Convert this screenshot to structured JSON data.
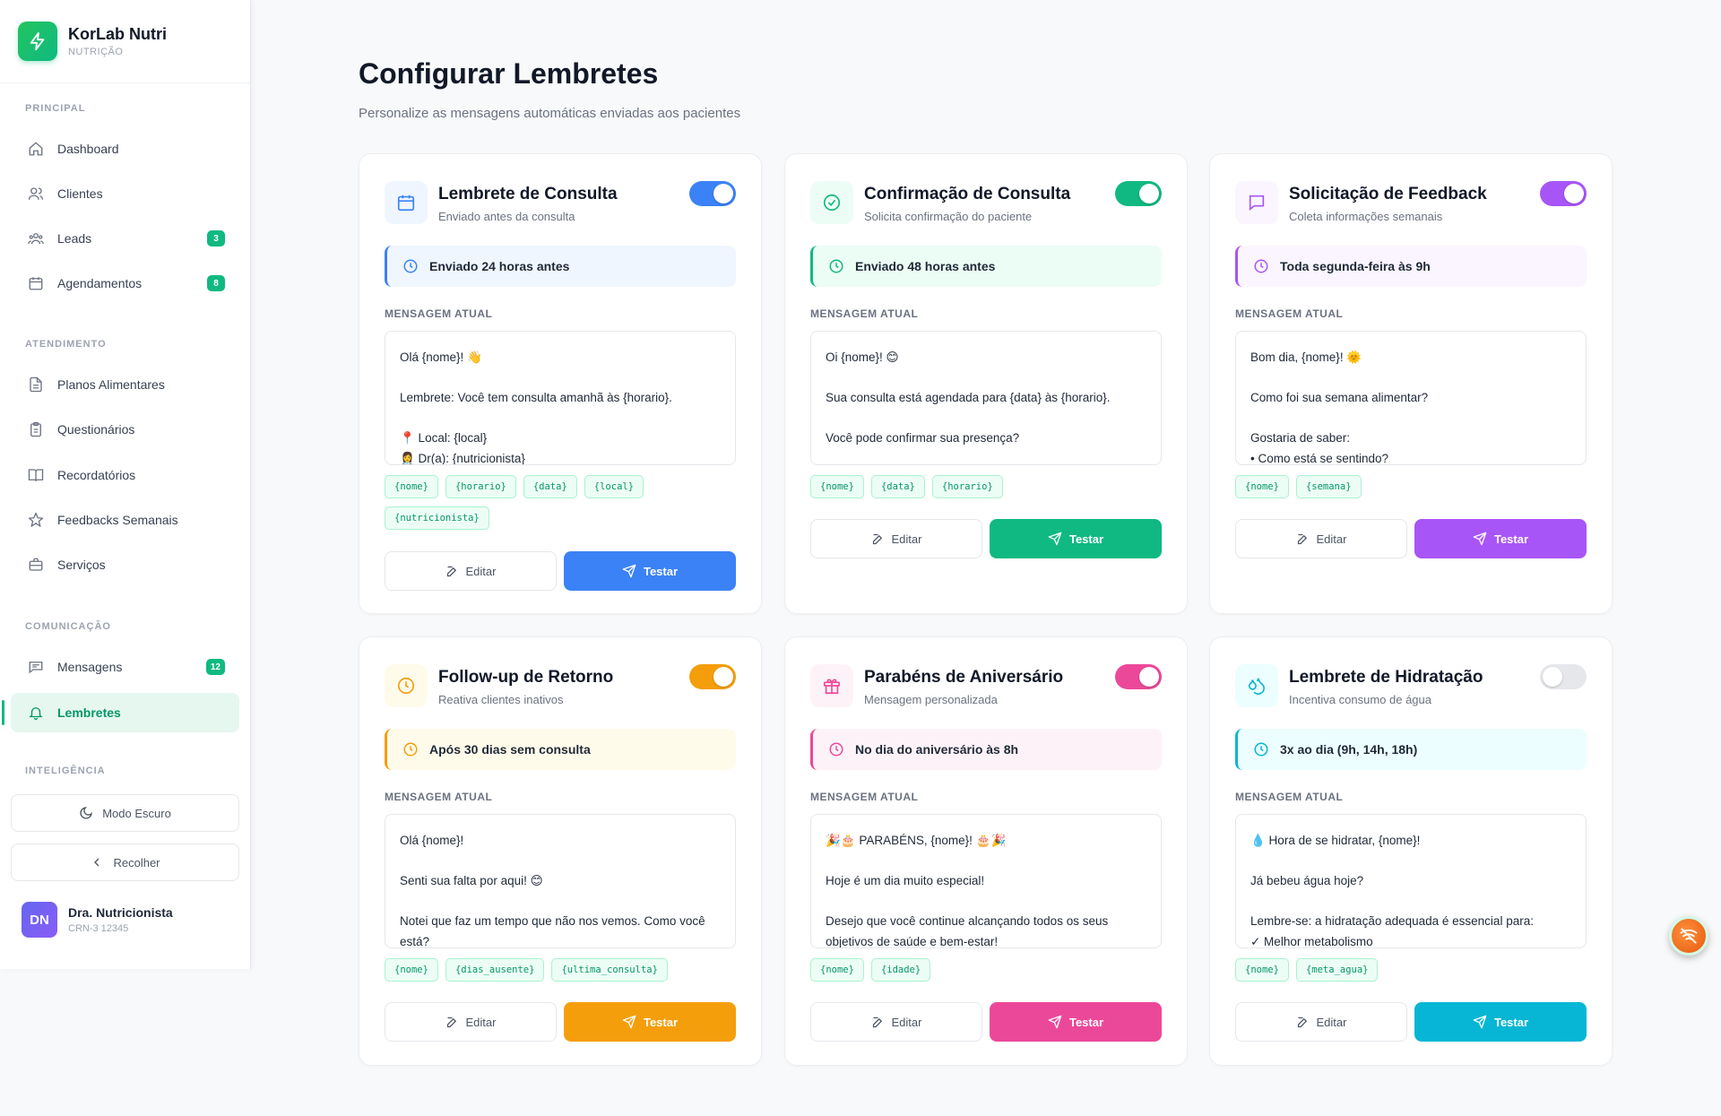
{
  "brand": {
    "name": "KorLab Nutri",
    "subtitle": "NUTRIÇÃO"
  },
  "sidebar": {
    "sections": {
      "principal": "PRINCIPAL",
      "atendimento": "ATENDIMENTO",
      "comunicacao": "COMUNICAÇÃO",
      "inteligencia": "INTELIGÊNCIA"
    },
    "items": [
      {
        "label": "Dashboard",
        "icon": "home-icon"
      },
      {
        "label": "Clientes",
        "icon": "users-icon"
      },
      {
        "label": "Leads",
        "icon": "leads-icon",
        "badge": "3"
      },
      {
        "label": "Agendamentos",
        "icon": "calendar-icon",
        "badge": "8"
      },
      {
        "label": "Planos Alimentares",
        "icon": "file-text-icon"
      },
      {
        "label": "Questionários",
        "icon": "clipboard-icon"
      },
      {
        "label": "Recordatórios",
        "icon": "book-icon"
      },
      {
        "label": "Feedbacks Semanais",
        "icon": "star-icon"
      },
      {
        "label": "Serviços",
        "icon": "briefcase-icon"
      },
      {
        "label": "Mensagens",
        "icon": "message-icon",
        "badge": "12"
      },
      {
        "label": "Lembretes",
        "icon": "bell-icon",
        "active": true
      }
    ],
    "dark_mode_label": "Modo Escuro",
    "collapse_label": "Recolher",
    "user": {
      "initials": "DN",
      "name": "Dra. Nutricionista",
      "crn": "CRN-3 12345"
    }
  },
  "page": {
    "title": "Configurar Lembretes",
    "subtitle": "Personalize as mensagens automáticas enviadas aos pacientes"
  },
  "labels": {
    "message": "MENSAGEM ATUAL",
    "edit": "Editar",
    "test": "Testar"
  },
  "cards": [
    {
      "title": "Lembrete de Consulta",
      "desc": "Enviado antes da consulta",
      "schedule": "Enviado 24 horas antes",
      "enabled": true,
      "icon": "calendar-icon",
      "color": "#3b82f6",
      "tint": "#eff6ff",
      "message": "Olá {nome}! 👋\n\nLembrete: Você tem consulta amanhã às {horario}.\n\n📍 Local: {local}\n👩‍⚕️ Dr(a): {nutricionista}",
      "vars": [
        "{nome}",
        "{horario}",
        "{data}",
        "{local}",
        "{nutricionista}"
      ]
    },
    {
      "title": "Confirmação de Consulta",
      "desc": "Solicita confirmação do paciente",
      "schedule": "Enviado 48 horas antes",
      "enabled": true,
      "icon": "check-circle-icon",
      "color": "#10b981",
      "tint": "#ecfdf5",
      "message": "Oi {nome}! 😊\n\nSua consulta está agendada para {data} às {horario}.\n\nVocê pode confirmar sua presença?",
      "vars": [
        "{nome}",
        "{data}",
        "{horario}"
      ]
    },
    {
      "title": "Solicitação de Feedback",
      "desc": "Coleta informações semanais",
      "schedule": "Toda segunda-feira às 9h",
      "enabled": true,
      "icon": "chat-icon",
      "color": "#a855f7",
      "tint": "#faf5ff",
      "message": "Bom dia, {nome}! 🌞\n\nComo foi sua semana alimentar?\n\nGostaria de saber:\n• Como está se sentindo?",
      "vars": [
        "{nome}",
        "{semana}"
      ]
    },
    {
      "title": "Follow-up de Retorno",
      "desc": "Reativa clientes inativos",
      "schedule": "Após 30 dias sem consulta",
      "enabled": true,
      "icon": "clock-icon",
      "color": "#f59e0b",
      "tint": "#fffbeb",
      "message": "Olá {nome}!\n\nSenti sua falta por aqui! 😊\n\nNotei que faz um tempo que não nos vemos. Como você está?",
      "vars": [
        "{nome}",
        "{dias_ausente}",
        "{ultima_consulta}"
      ]
    },
    {
      "title": "Parabéns de Aniversário",
      "desc": "Mensagem personalizada",
      "schedule": "No dia do aniversário às 8h",
      "enabled": true,
      "icon": "gift-icon",
      "color": "#ec4899",
      "tint": "#fdf2f8",
      "message": "🎉🎂 PARABÉNS, {nome}! 🎂🎉\n\nHoje é um dia muito especial!\n\nDesejo que você continue alcançando todos os seus objetivos de saúde e bem-estar!",
      "vars": [
        "{nome}",
        "{idade}"
      ]
    },
    {
      "title": "Lembrete de Hidratação",
      "desc": "Incentiva consumo de água",
      "schedule": "3x ao dia (9h, 14h, 18h)",
      "enabled": false,
      "icon": "droplets-icon",
      "color": "#06b6d4",
      "tint": "#ecfeff",
      "message": "💧 Hora de se hidratar, {nome}!\n\nJá bebeu água hoje?\n\nLembre-se: a hidratação adequada é essencial para:\n✓ Melhor metabolismo",
      "vars": [
        "{nome}",
        "{meta_agua}"
      ]
    }
  ]
}
